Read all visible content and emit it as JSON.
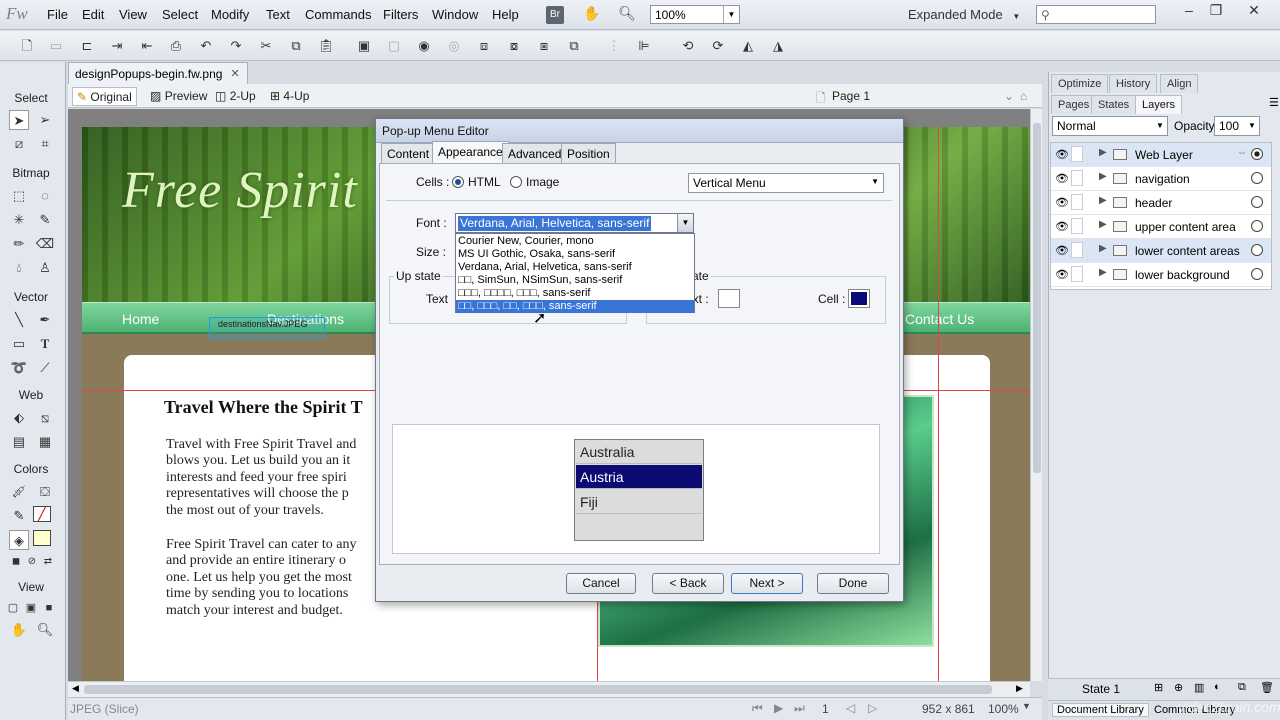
{
  "app": {
    "logo": "Fw",
    "menus": [
      "File",
      "Edit",
      "View",
      "Select",
      "Modify",
      "Text",
      "Commands",
      "Filters",
      "Window",
      "Help"
    ],
    "bridge_label": "Br",
    "zoom": "100%",
    "workspace_mode": "Expanded Mode",
    "search_placeholder": ""
  },
  "document": {
    "tab_title": "designPopups-begin.fw.png",
    "view_tabs": [
      "Original",
      "Preview",
      "2-Up",
      "4-Up"
    ],
    "page_label": "Page 1"
  },
  "tools": {
    "sections": [
      "Select",
      "Bitmap",
      "Vector",
      "Web",
      "Colors",
      "View"
    ]
  },
  "design": {
    "logo_text": "Free Spirit",
    "nav": [
      "Home",
      "Destinations",
      "Contact Us"
    ],
    "slice_label": "destinationsNav.JPEG",
    "heading": "Travel Where the Spirit T",
    "para1": "Travel with Free Spirit Travel and\nblows you. Let us build you an it\ninterests and feed your free spiri\nrepresentatives will choose the p\nthe most out of your travels.",
    "para2": "Free Spirit Travel can cater to any\nand provide an entire itinerary o\none. Let us help you get the most\ntime by sending you to locations\nmatch your interest and budget."
  },
  "dialog": {
    "title": "Pop-up Menu Editor",
    "tabs": [
      "Content",
      "Appearance",
      "Advanced",
      "Position"
    ],
    "active_tab": "Appearance",
    "cells_label": "Cells :",
    "cells_html": "HTML",
    "cells_image": "Image",
    "orientation": "Vertical Menu",
    "font_label": "Font :",
    "font_value": "Verdana, Arial, Helvetica, sans-serif",
    "size_label": "Size :",
    "font_options": [
      "Courier New, Courier, mono",
      "MS UI Gothic, Osaka, sans-serif",
      "Verdana, Arial, Helvetica, sans-serif",
      "□□, SimSun, NSimSun, sans-serif",
      "□□□, □□□□, □□□, sans-serif",
      "□□, □□□, □□, □□□, sans-serif"
    ],
    "up_state_label": "Up state",
    "over_state_label": "ate",
    "text_label": "Text",
    "over_text_label": "ext :",
    "cell_label": "Cell :",
    "cell_color": "#0a0a7a",
    "preview_items": [
      "Australia",
      "Austria",
      "Fiji"
    ],
    "buttons": {
      "cancel": "Cancel",
      "back": "< Back",
      "next": "Next >",
      "done": "Done"
    }
  },
  "panels": {
    "top_tabs": [
      "Optimize",
      "History",
      "Align"
    ],
    "sub_tabs": [
      "Pages",
      "States",
      "Layers"
    ],
    "blend_mode": "Normal",
    "opacity_label": "Opacity",
    "opacity_value": "100",
    "layers": [
      {
        "name": "Web Layer"
      },
      {
        "name": "navigation"
      },
      {
        "name": "header"
      },
      {
        "name": "upper content area"
      },
      {
        "name": "lower content areas"
      },
      {
        "name": "lower background"
      }
    ],
    "state_label": "State 1",
    "library_tabs": [
      "Document Library",
      "Common Library"
    ]
  },
  "status": {
    "slice_info": "JPEG (Slice)",
    "frame": "1",
    "dimensions": "952 x 861",
    "zoom": "100%"
  },
  "watermark": "video2brain.com"
}
